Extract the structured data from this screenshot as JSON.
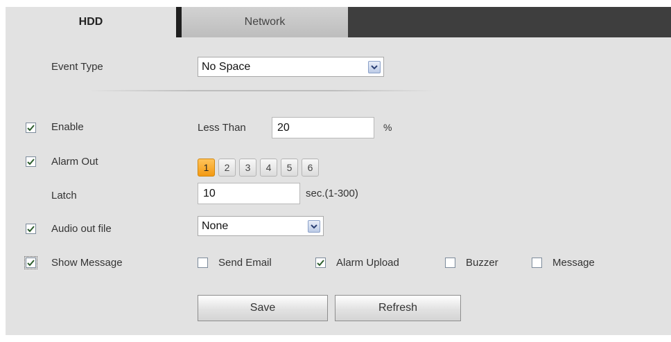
{
  "tabs": [
    {
      "label": "HDD",
      "active": true
    },
    {
      "label": "Network",
      "active": false
    }
  ],
  "event_type": {
    "label": "Event Type",
    "value": "No Space"
  },
  "enable": {
    "label": "Enable",
    "checked": true,
    "prefix": "Less Than",
    "value": "20",
    "unit": "%"
  },
  "alarm_out": {
    "label": "Alarm Out",
    "checked": true,
    "channels": [
      "1",
      "2",
      "3",
      "4",
      "5",
      "6"
    ],
    "active_channel": "1"
  },
  "latch": {
    "label": "Latch",
    "value": "10",
    "unit": "sec.(1-300)"
  },
  "audio_out": {
    "label": "Audio out file",
    "checked": true,
    "value": "None"
  },
  "show_message": {
    "label": "Show Message",
    "checked": true
  },
  "options": [
    {
      "label": "Send Email",
      "checked": false
    },
    {
      "label": "Alarm Upload",
      "checked": true
    },
    {
      "label": "Buzzer",
      "checked": false
    },
    {
      "label": "Message",
      "checked": false
    }
  ],
  "buttons": {
    "save": "Save",
    "refresh": "Refresh"
  },
  "icons": {
    "dropdown": "chevron-down-icon",
    "check": "check-icon"
  },
  "colors": {
    "active_channel": "#f5a623",
    "tab_bar": "#3e3e3e",
    "panel": "#e2e2e2"
  }
}
